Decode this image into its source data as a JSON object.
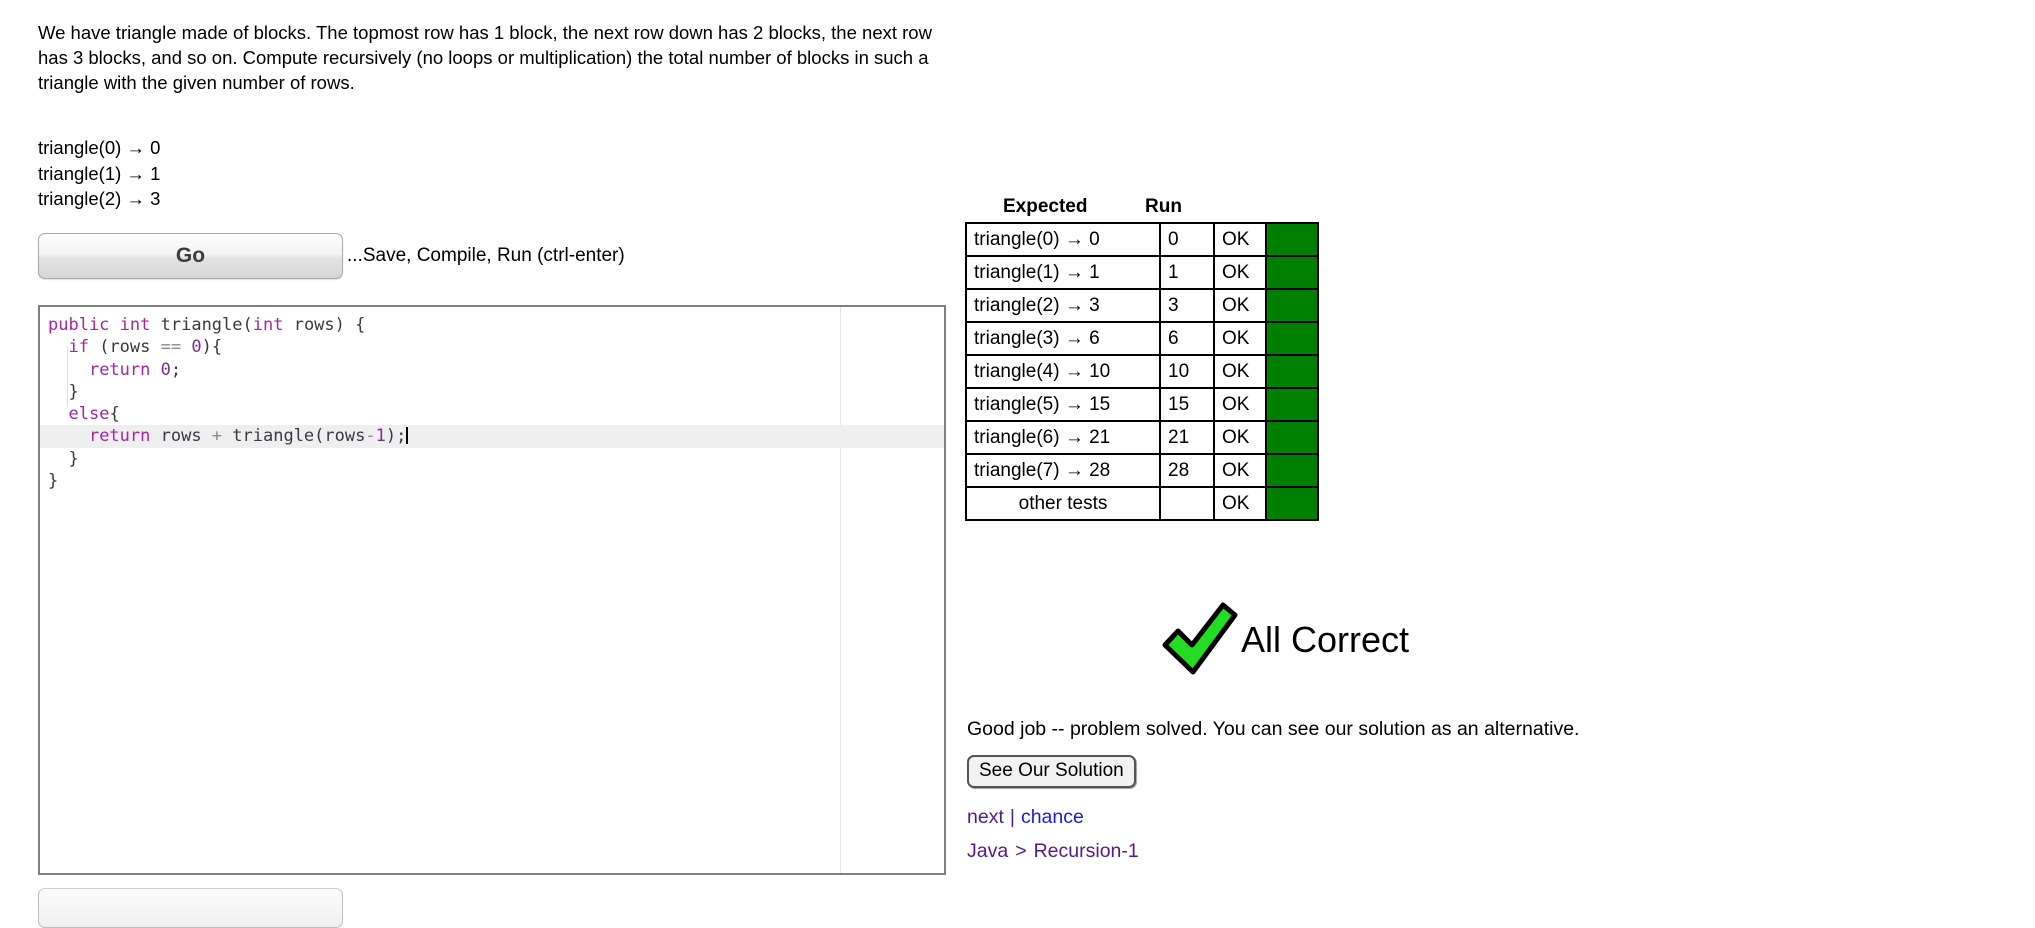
{
  "problem": {
    "statement": "We have triangle made of blocks. The topmost row has 1 block, the next row down has 2 blocks, the next row has 3 blocks, and so on. Compute recursively (no loops or multiplication) the total number of blocks in such a triangle with the given number of rows.",
    "examples": "triangle(0) → 0\ntriangle(1) → 1\ntriangle(2) → 3"
  },
  "toolbar": {
    "go_label": "Go",
    "go_hint": "...Save, Compile, Run (ctrl-enter)"
  },
  "editor": {
    "language": "Java",
    "lines": [
      {
        "indent": 0,
        "active": false,
        "tokens": [
          {
            "t": "public",
            "c": "kw"
          },
          {
            "t": " ",
            "c": "plain"
          },
          {
            "t": "int",
            "c": "kw"
          },
          {
            "t": " triangle(",
            "c": "plain"
          },
          {
            "t": "int",
            "c": "kw"
          },
          {
            "t": " rows) {",
            "c": "plain"
          }
        ]
      },
      {
        "indent": 1,
        "active": false,
        "tokens": [
          {
            "t": "if",
            "c": "kw"
          },
          {
            "t": " (rows ",
            "c": "plain"
          },
          {
            "t": "==",
            "c": "op"
          },
          {
            "t": " ",
            "c": "plain"
          },
          {
            "t": "0",
            "c": "num"
          },
          {
            "t": "){",
            "c": "plain"
          }
        ]
      },
      {
        "indent": 2,
        "active": false,
        "tokens": [
          {
            "t": "return",
            "c": "kw"
          },
          {
            "t": " ",
            "c": "plain"
          },
          {
            "t": "0",
            "c": "num"
          },
          {
            "t": ";",
            "c": "plain"
          }
        ]
      },
      {
        "indent": 1,
        "active": false,
        "tokens": [
          {
            "t": "}",
            "c": "plain"
          }
        ]
      },
      {
        "indent": 1,
        "active": false,
        "tokens": [
          {
            "t": "else",
            "c": "kw"
          },
          {
            "t": "{",
            "c": "plain"
          }
        ]
      },
      {
        "indent": 2,
        "active": true,
        "caret": true,
        "tokens": [
          {
            "t": "return",
            "c": "kw"
          },
          {
            "t": " rows ",
            "c": "plain"
          },
          {
            "t": "+",
            "c": "op"
          },
          {
            "t": " triangle(rows",
            "c": "plain"
          },
          {
            "t": "-",
            "c": "op"
          },
          {
            "t": "1",
            "c": "num"
          },
          {
            "t": ");",
            "c": "plain"
          }
        ]
      },
      {
        "indent": 1,
        "active": false,
        "tokens": [
          {
            "t": "}",
            "c": "plain"
          }
        ]
      },
      {
        "indent": 0,
        "active": false,
        "tokens": [
          {
            "t": "}",
            "c": "plain"
          }
        ]
      }
    ]
  },
  "results": {
    "headers": {
      "expected": "Expected",
      "run": "Run"
    },
    "rows": [
      {
        "expected": "triangle(0) → 0",
        "run": "0",
        "status": "OK",
        "pass": true,
        "center": false
      },
      {
        "expected": "triangle(1) → 1",
        "run": "1",
        "status": "OK",
        "pass": true,
        "center": false
      },
      {
        "expected": "triangle(2) → 3",
        "run": "3",
        "status": "OK",
        "pass": true,
        "center": false
      },
      {
        "expected": "triangle(3) → 6",
        "run": "6",
        "status": "OK",
        "pass": true,
        "center": false
      },
      {
        "expected": "triangle(4) → 10",
        "run": "10",
        "status": "OK",
        "pass": true,
        "center": false
      },
      {
        "expected": "triangle(5) → 15",
        "run": "15",
        "status": "OK",
        "pass": true,
        "center": false
      },
      {
        "expected": "triangle(6) → 21",
        "run": "21",
        "status": "OK",
        "pass": true,
        "center": false
      },
      {
        "expected": "triangle(7) → 28",
        "run": "28",
        "status": "OK",
        "pass": true,
        "center": false
      },
      {
        "expected": "other tests",
        "run": "",
        "status": "OK",
        "pass": true,
        "center": true
      }
    ],
    "pass_color": "#008000"
  },
  "verdict": {
    "icon": "check-mark-icon",
    "label": "All Correct",
    "message": "Good job -- problem solved. You can see our solution as an alternative.",
    "check_fill": "#22DD22",
    "check_stroke": "#000000"
  },
  "actions": {
    "see_solution_label": "See Our Solution"
  },
  "nav": {
    "next_label": "next",
    "separator": "|",
    "chance_label": "chance"
  },
  "breadcrumb": {
    "root": "Java",
    "separator": ">",
    "section": "Recursion-1"
  }
}
